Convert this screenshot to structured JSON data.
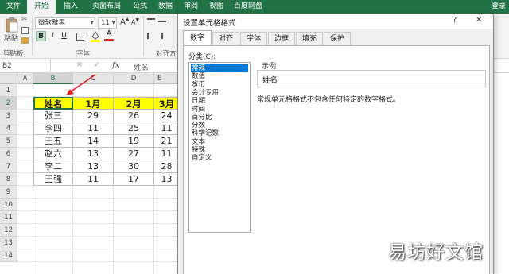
{
  "ribbon_tabs": [
    "文件",
    "开始",
    "插入",
    "页面布局",
    "公式",
    "数据",
    "审阅",
    "视图",
    "百度网盘"
  ],
  "login": "登录",
  "ribbon": {
    "paste": "粘贴",
    "clipboard_group": "剪贴板",
    "font_name": "微软雅黑",
    "font_size": "11",
    "bold": "B",
    "italic": "I",
    "underline": "U",
    "font_group": "字体",
    "align_group": "对齐方式",
    "font_color_glyph": "A",
    "font_color_hex": "#e03030",
    "fill_color_hex": "#ffff00"
  },
  "formula_bar": {
    "name_box": "B2",
    "cancel": "✕",
    "enter": "✓",
    "fx": "fx",
    "content": "姓名"
  },
  "grid": {
    "columns": [
      "A",
      "B",
      "C",
      "D",
      "E"
    ],
    "rows": [
      "1",
      "2",
      "3",
      "4",
      "5",
      "6",
      "7",
      "8",
      "9",
      "10",
      "11",
      "12",
      "13",
      "14"
    ],
    "header": [
      "姓名",
      "1月",
      "2月",
      "3月"
    ],
    "data": [
      [
        "张三",
        "29",
        "26",
        "24"
      ],
      [
        "李四",
        "11",
        "25",
        "11"
      ],
      [
        "王五",
        "14",
        "19",
        "21"
      ],
      [
        "赵六",
        "13",
        "27",
        "11"
      ],
      [
        "李二",
        "13",
        "30",
        "28"
      ],
      [
        "王强",
        "11",
        "17",
        "13"
      ]
    ],
    "header_fill": "#ffff00"
  },
  "dialog": {
    "title": "设置单元格格式",
    "help": "?",
    "close": "✕",
    "tabs": [
      "数字",
      "对齐",
      "字体",
      "边框",
      "填充",
      "保护"
    ],
    "category_label": "分类(C):",
    "categories": [
      "常规",
      "数值",
      "货币",
      "会计专用",
      "日期",
      "时间",
      "百分比",
      "分数",
      "科学记数",
      "文本",
      "特殊",
      "自定义"
    ],
    "selected_category": "常规",
    "sample_label": "示例",
    "sample_value": "姓名",
    "description": "常规单元格格式不包含任何特定的数字格式。"
  },
  "watermark": "易坊好文馆",
  "colors": {
    "excel_green": "#217346",
    "selection_blue": "#0078d7",
    "arrow_red": "#e02020"
  }
}
